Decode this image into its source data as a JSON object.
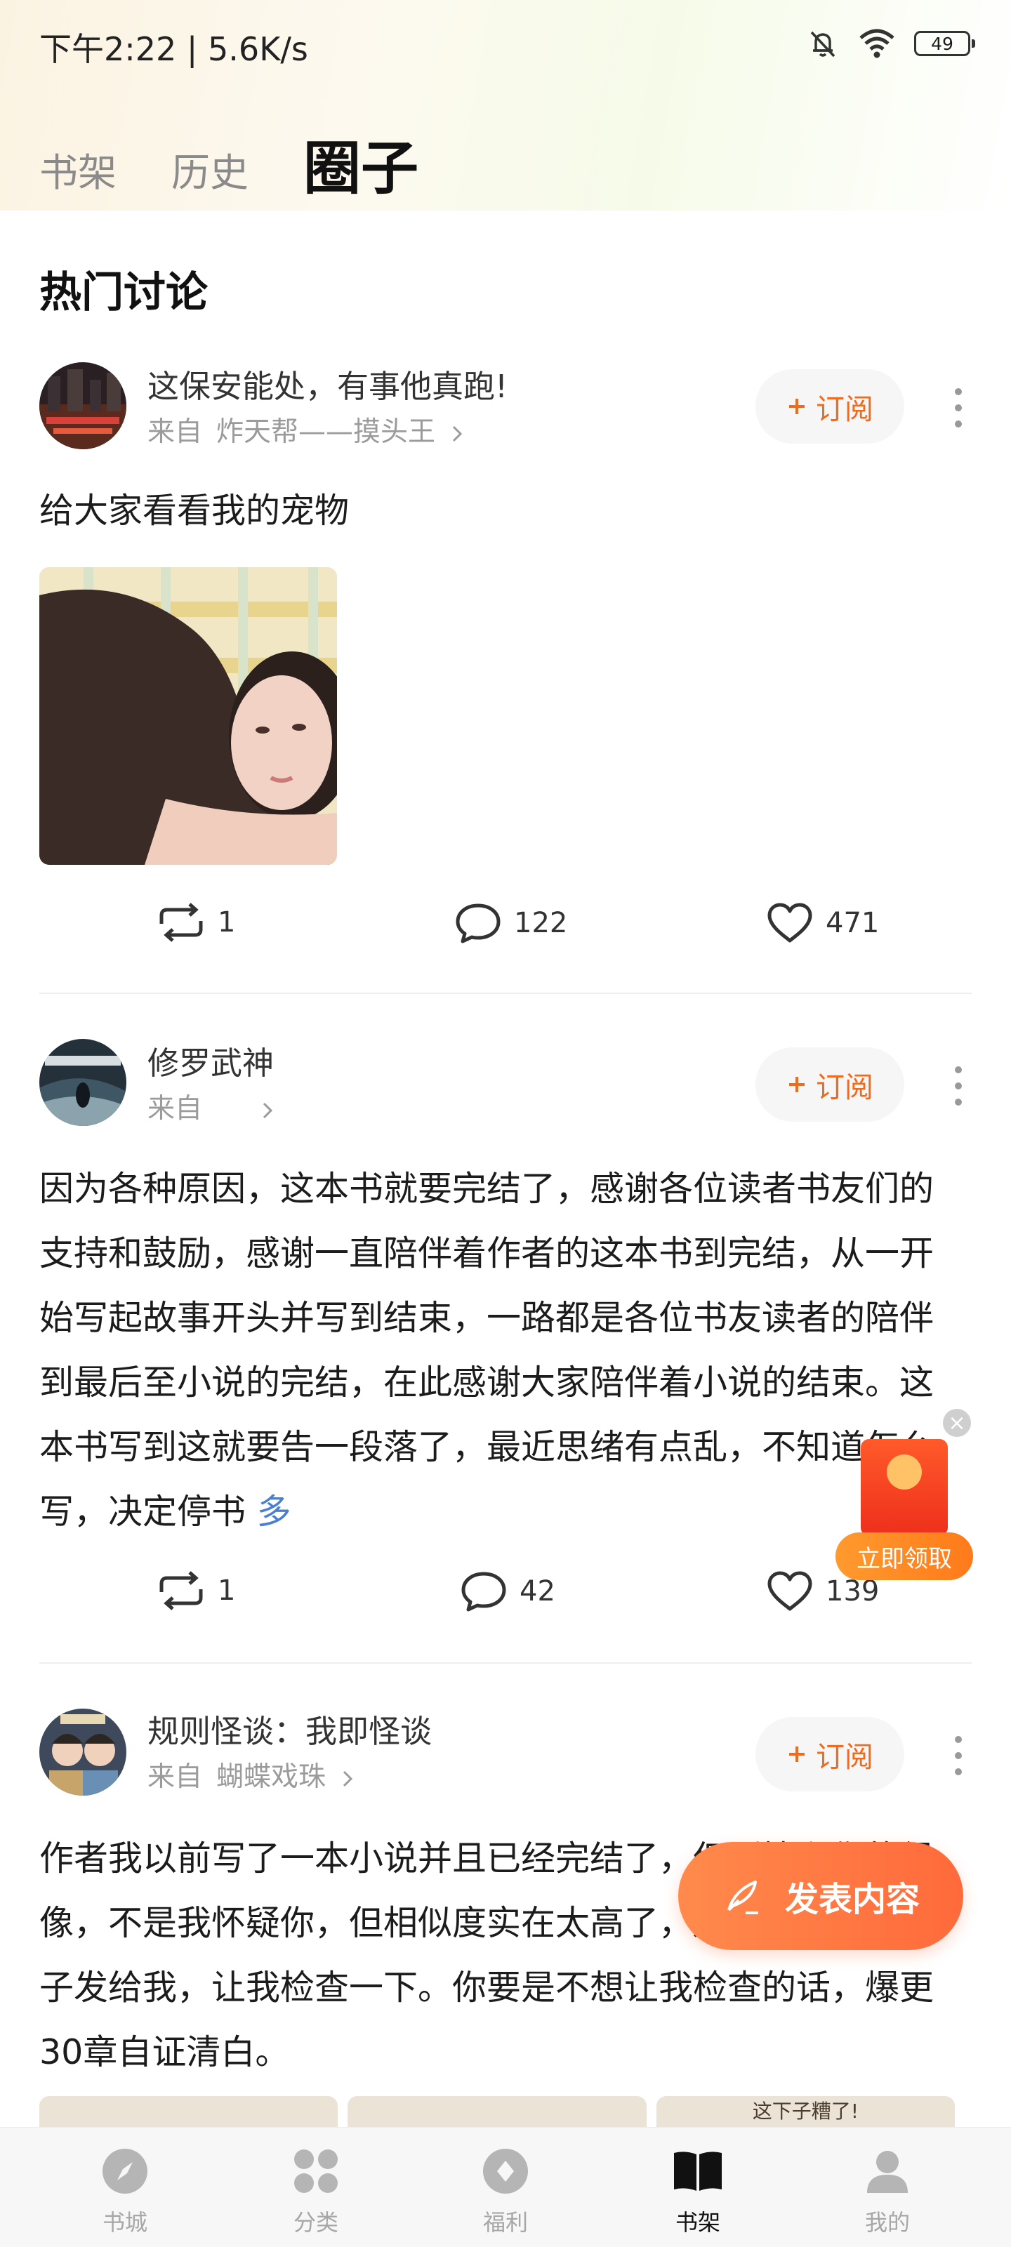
{
  "status_bar": {
    "time": "下午2:22 | 5.6K/s",
    "battery": "49"
  },
  "top_tabs": [
    {
      "label": "书架"
    },
    {
      "label": "历史"
    },
    {
      "label": "圈子",
      "active": true
    }
  ],
  "section_title": "热门讨论",
  "posts": [
    {
      "book": "这保安能处，有事他真跑!",
      "from_label": "来自",
      "source": "炸天帮——摸头王",
      "subscribe": "订阅",
      "text": "给大家看看我的宠物",
      "repost": "1",
      "comments": "122",
      "likes": "471"
    },
    {
      "book": "修罗武神",
      "from_label": "来自",
      "source": "",
      "subscribe": "订阅",
      "text": "因为各种原因，这本书就要完结了，感谢各位读者书友们的支持和鼓励，感谢一直陪伴着作者的这本书到完结，从一开始写起故事开头并写到结束，一路都是各位书友读者的陪伴到最后至小说的完结，在此感谢大家陪伴着小说的结束。这本书写到这就要告一段落了，最近思绪有点乱，不知道怎么写，决定停书",
      "more": "多",
      "repost": "1",
      "comments": "42",
      "likes": "139"
    },
    {
      "book": "规则怪谈：我即怪谈",
      "from_label": "来自",
      "source": "蝴蝶戏珠",
      "subscribe": "订阅",
      "text": "作者我以前写了一本小说并且已经完结了，但剧情和你的很像，不是我怀疑你，但相似度实在太高了，麻烦你把你的稿子发给我，让我检查一下。你要是不想让我检查的话，爆更30章自证清白。"
    }
  ],
  "thumb_caption": "这下子糟了!",
  "red_packet": {
    "label": "立即领取"
  },
  "fab": {
    "label": "发表内容"
  },
  "bottom_nav": [
    {
      "label": "书城",
      "icon": "compass-icon"
    },
    {
      "label": "分类",
      "icon": "category-icon"
    },
    {
      "label": "福利",
      "icon": "gift-icon"
    },
    {
      "label": "书架",
      "icon": "book-icon",
      "active": true
    },
    {
      "label": "我的",
      "icon": "person-icon"
    }
  ],
  "colors": {
    "accent": "#f26a1b",
    "fab": "#ff7a45"
  }
}
